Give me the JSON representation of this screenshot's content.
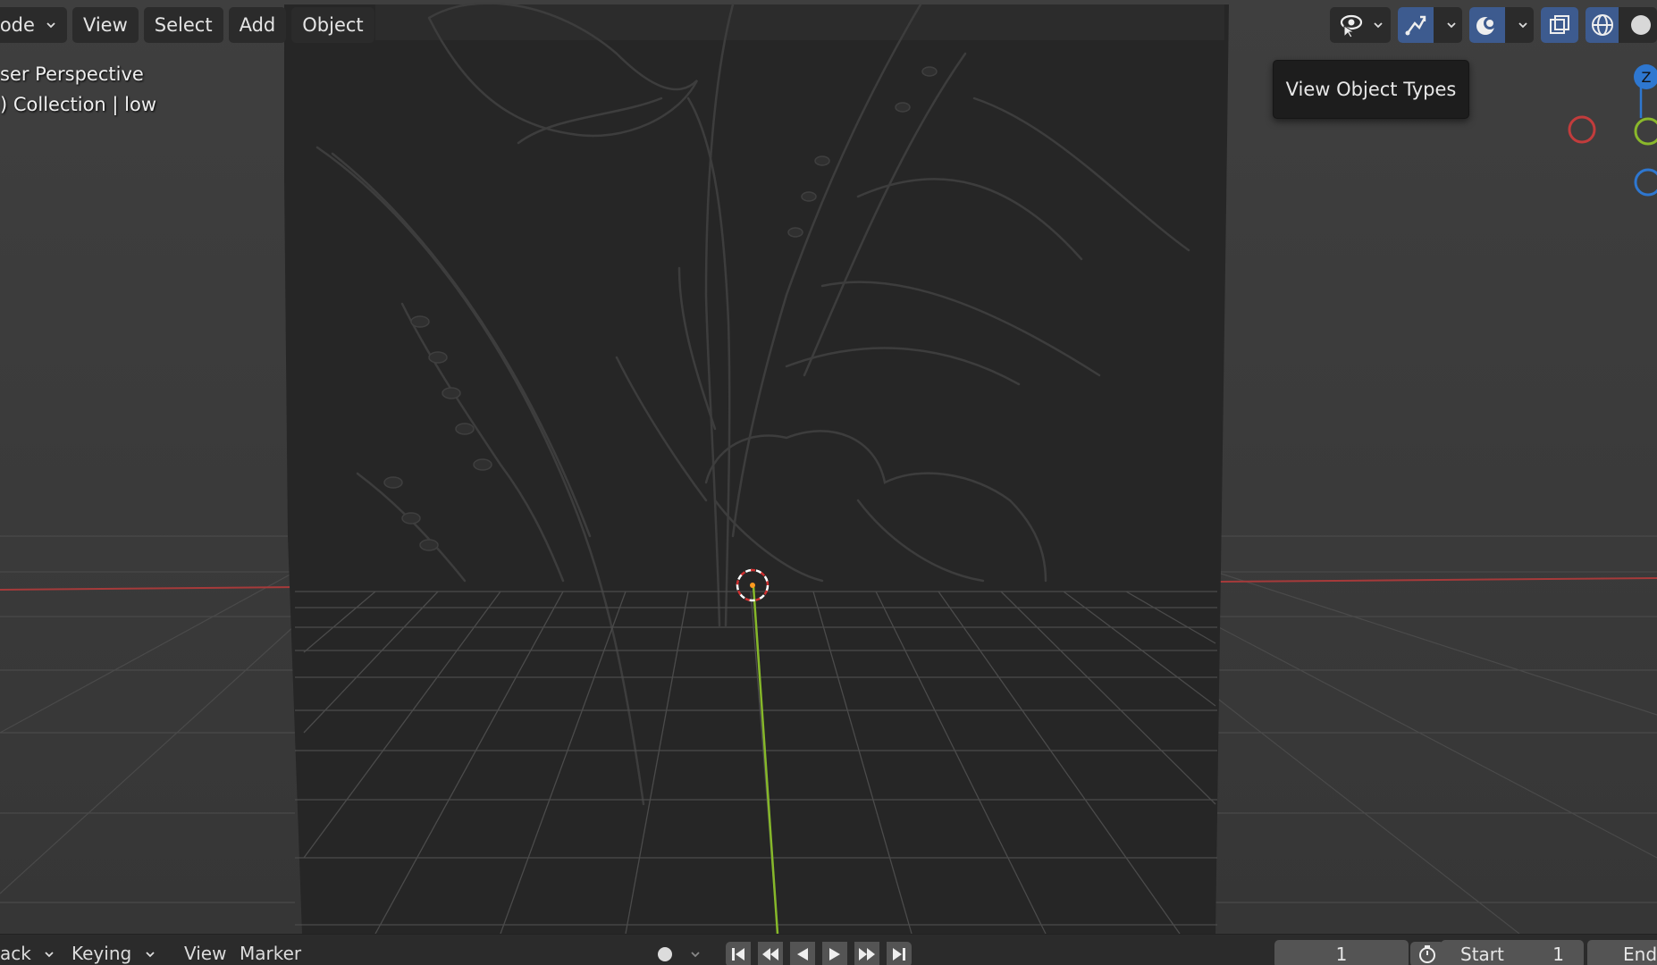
{
  "header": {
    "mode_label": "lode",
    "menu": [
      "View",
      "Select",
      "Add",
      "Object"
    ]
  },
  "viewport": {
    "perspective_label": "ser Perspective",
    "collection_label": ") Collection | low"
  },
  "tooltip": {
    "text": "View Object Types"
  },
  "gizmo": {
    "z_label": "Z"
  },
  "timeline": {
    "playback_label": "ack",
    "keying_label": "Keying",
    "view_label": "View",
    "marker_label": "Marker",
    "current_frame": "1",
    "start_label": "Start",
    "start_value": "1",
    "end_label": "End"
  },
  "colors": {
    "accent_blue": "#3d5b8f",
    "x_axis_red": "#b93a3a",
    "y_axis_green": "#8ab82b",
    "z_axis_blue": "#2e77d0"
  }
}
